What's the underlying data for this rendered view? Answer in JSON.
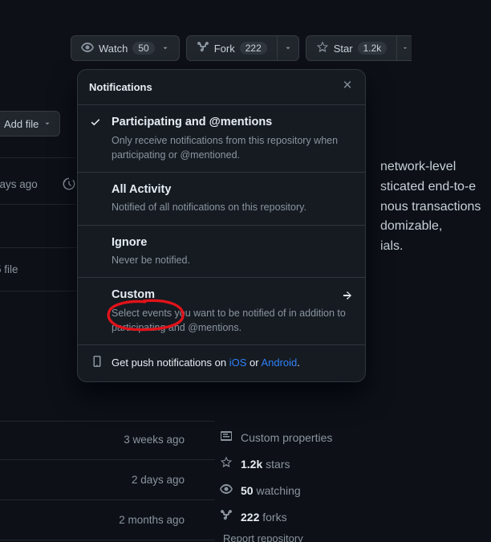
{
  "actions": {
    "watch": {
      "label": "Watch",
      "count": "50"
    },
    "fork": {
      "label": "Fork",
      "count": "222"
    },
    "star": {
      "label": "Star",
      "count": "1.2k"
    }
  },
  "dropdown": {
    "title": "Notifications",
    "items": [
      {
        "title": "Participating and @mentions",
        "desc": "Only receive notifications from this repository when participating or @mentioned.",
        "selected": true
      },
      {
        "title": "All Activity",
        "desc": "Notified of all notifications on this repository."
      },
      {
        "title": "Ignore",
        "desc": "Never be notified."
      },
      {
        "title": "Custom",
        "desc": "Select events you want to be notified of in addition to participating and @mentions.",
        "has_arrow": true
      }
    ],
    "footer": {
      "pre": "Get push notifications on ",
      "ios": "iOS",
      "or": " or ",
      "android": "Android",
      "post": "."
    }
  },
  "background": {
    "addfile": "Add file",
    "latest_age": "days ago",
    "file_label_partial": "5 file",
    "about_lines": [
      "network-level",
      "sticated end-to-e",
      "nous transactions",
      "domizable,",
      "ials."
    ],
    "file_ages": [
      "3 weeks ago",
      "2 days ago",
      "2 months ago"
    ],
    "sidebar": {
      "custom_properties": "Custom properties",
      "stars_num": "1.2k",
      "stars_word": " stars",
      "watching_num": "50",
      "watching_word": " watching",
      "forks_num": "222",
      "forks_word": " forks",
      "report": "Report repository"
    }
  }
}
